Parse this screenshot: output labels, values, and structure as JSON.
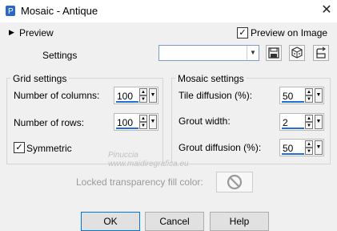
{
  "window": {
    "title": "Mosaic - Antique",
    "close_glyph": "✕",
    "icon": "app-icon"
  },
  "preview": {
    "label": "Preview",
    "on_image_label": "Preview on Image",
    "on_image_checked": true
  },
  "settings": {
    "label": "Settings",
    "value": ""
  },
  "grid": {
    "title": "Grid settings",
    "columns_label": "Number of columns:",
    "columns_value": "100",
    "rows_label": "Number of rows:",
    "rows_value": "100",
    "symmetric_label": "Symmetric",
    "symmetric_checked": true
  },
  "mosaic": {
    "title": "Mosaic settings",
    "tile_label": "Tile diffusion (%):",
    "tile_value": "50",
    "grout_width_label": "Grout width:",
    "grout_width_value": "2",
    "grout_diffusion_label": "Grout diffusion (%):",
    "grout_diffusion_value": "50"
  },
  "watermark": "Pinuccia\nwww.maidiregrafica.eu",
  "locked_fill": {
    "label": "Locked transparency fill color:"
  },
  "buttons": {
    "ok": "OK",
    "cancel": "Cancel",
    "help": "Help"
  },
  "colors": {
    "accent": "#1e70d6",
    "background": "#f0f0f0"
  }
}
